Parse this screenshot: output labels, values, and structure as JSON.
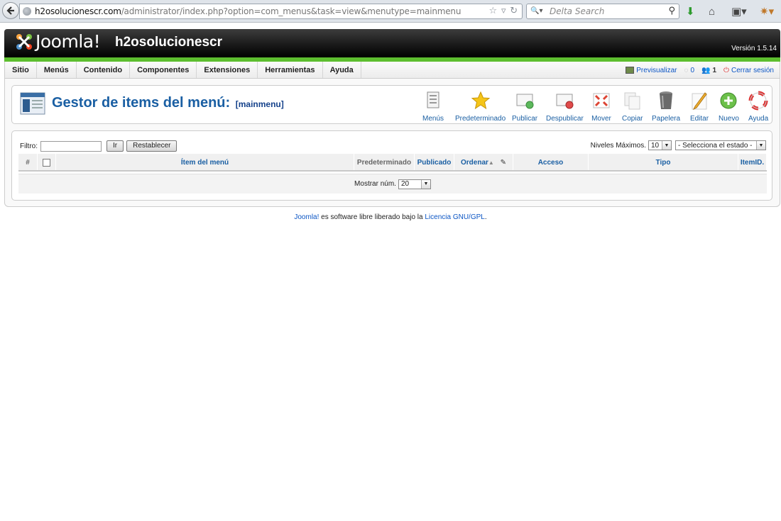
{
  "browser": {
    "url_host": "h2osolucionescr.com",
    "url_path": "/administrator/index.php?option=com_menus&task=view&menutype=mainmenu",
    "search_placeholder": "Delta Search"
  },
  "header": {
    "logo_text": "Joomla!",
    "site_name": "h2osolucionescr",
    "version": "Versión 1.5.14"
  },
  "menubar": {
    "items": [
      "Sitio",
      "Menús",
      "Contenido",
      "Componentes",
      "Extensiones",
      "Herramientas",
      "Ayuda"
    ],
    "preview": "Previsualizar",
    "messages_count": "0",
    "users_count": "1",
    "logout": "Cerrar sesión"
  },
  "toolbar": {
    "title": "Gestor de items del menú:",
    "subtitle": "[mainmenu]",
    "buttons": [
      "Menús",
      "Predeterminado",
      "Publicar",
      "Despublicar",
      "Mover",
      "Copiar",
      "Papelera",
      "Editar",
      "Nuevo",
      "Ayuda"
    ]
  },
  "filter": {
    "label": "Filtro:",
    "value": "",
    "go": "Ir",
    "reset": "Restablecer",
    "levels_label": "Niveles Máximos.",
    "levels_value": "10",
    "state_value": "- Selecciona el estado -"
  },
  "table": {
    "columns": [
      "#",
      "",
      "Ítem del menú",
      "Predeterminado",
      "Publicado",
      "Ordenar",
      "Acceso",
      "Tipo",
      "ItemID."
    ],
    "display_label": "Mostrar núm.",
    "display_value": "20"
  },
  "footer": {
    "brand": "Joomla!",
    "middle": " es software libre liberado bajo la ",
    "license": "Licencia GNU/GPL",
    "end": "."
  },
  "colors": {
    "accent": "#1a5fa3",
    "header_green": "#5dbe2f",
    "link": "#0b55c4"
  }
}
